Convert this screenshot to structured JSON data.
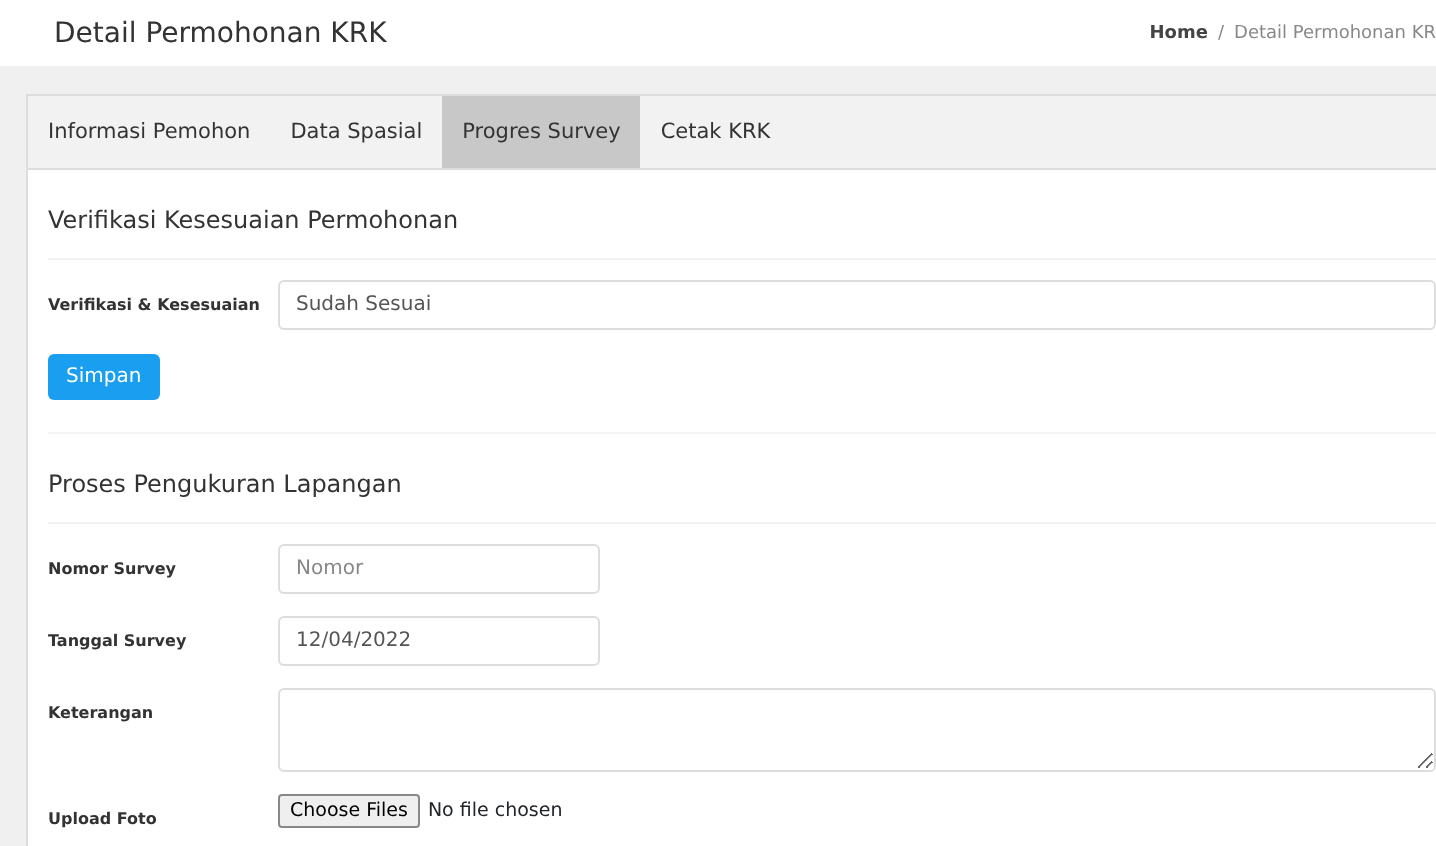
{
  "page_title": "Detail Permohonan KRK",
  "breadcrumb": [
    {
      "label": "Home",
      "selected": false
    },
    {
      "label": "Detail Permohonan KR",
      "selected": true
    }
  ],
  "breadcrumb_separator": "/",
  "tabs": [
    {
      "label": "Informasi Pemohon",
      "selected": false
    },
    {
      "label": "Data Spasial",
      "selected": false
    },
    {
      "label": "Progres Survey",
      "selected": true
    },
    {
      "label": "Cetak KRK",
      "selected": false
    }
  ],
  "sections": [
    {
      "title": "Verifikasi Kesesuaian Permohonan",
      "fields": [
        {
          "kind": "wide-text",
          "label": "Verifikasi & Kesesuaian",
          "value": "Sudah Sesuai"
        }
      ],
      "button": "Simpan"
    },
    {
      "title": "Proses Pengukuran Lapangan",
      "fields": [
        {
          "kind": "short-text",
          "label": "Nomor Survey",
          "placeholder": "Nomor"
        },
        {
          "kind": "short-text",
          "label": "Tanggal Survey",
          "value": "12/04/2022"
        },
        {
          "kind": "textarea",
          "label": "Keterangan"
        },
        {
          "kind": "file",
          "label": "Upload Foto",
          "button": "Choose Files",
          "status": "No file chosen"
        }
      ]
    }
  ]
}
